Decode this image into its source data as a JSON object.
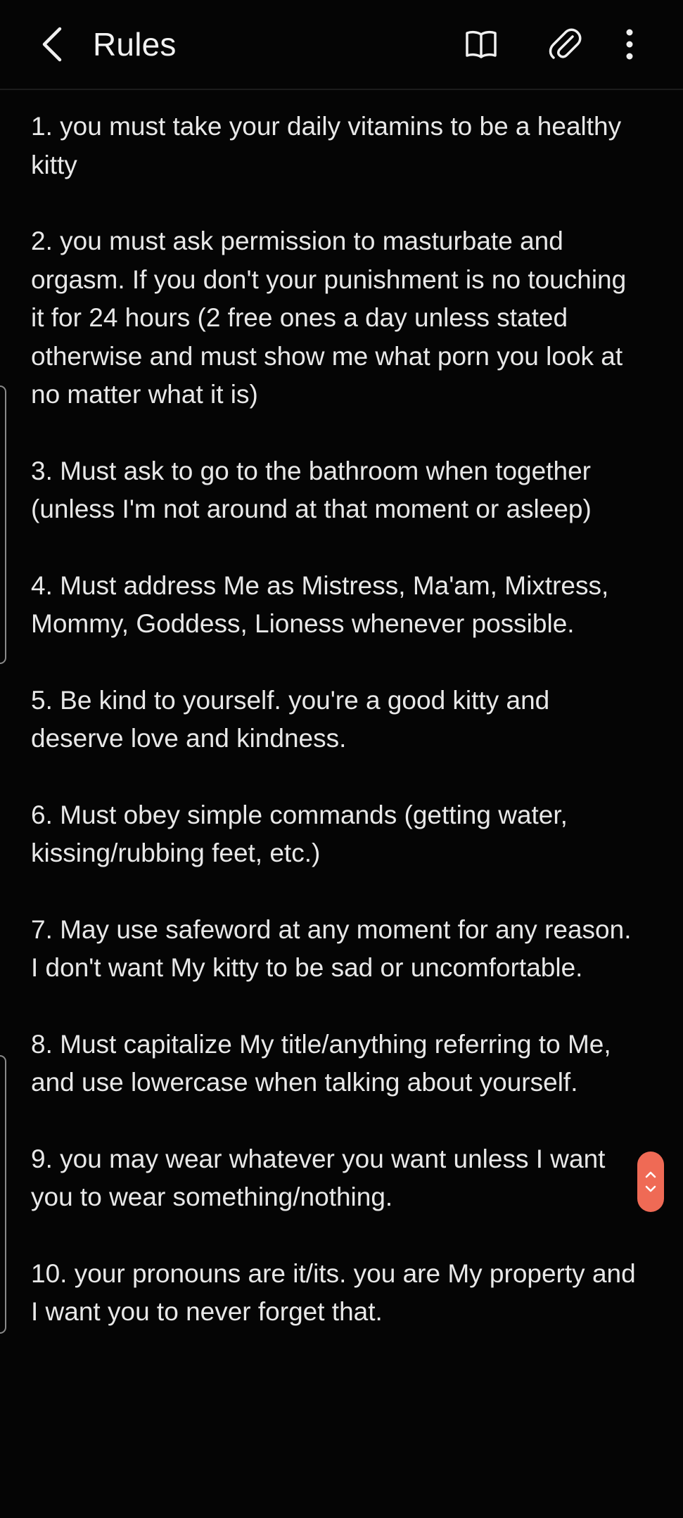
{
  "header": {
    "title": "Rules",
    "back_icon": "chevron-left-icon",
    "reading_icon": "book-icon",
    "attach_icon": "paperclip-icon",
    "more_icon": "more-vertical-icon"
  },
  "rules": [
    "1. you must take your daily vitamins to be a healthy kitty",
    "2. you must ask permission to masturbate and orgasm. If you don't your punishment is no touching it for 24 hours (2 free ones a day unless stated otherwise and must show me what porn you look at no matter what it is)",
    "3. Must ask to go to the bathroom when together (unless I'm not around at that moment or asleep)",
    "4. Must address Me as Mistress, Ma'am, Mixtress, Mommy, Goddess, Lioness whenever possible.",
    "5. Be kind to yourself. you're a good kitty and deserve love and kindness.",
    "6. Must obey simple commands (getting water, kissing/rubbing feet, etc.)",
    "7. May use safeword at any moment for any reason. I don't want My kitty to be sad or uncomfortable.",
    "8. Must capitalize My title/anything referring to Me, and use lowercase when talking about yourself.",
    "9. you may wear whatever you want unless I want you to wear something/nothing.",
    "10. your pronouns are it/its. you are My property and I want you to never forget that."
  ],
  "colors": {
    "background": "#050505",
    "text": "#e8e8e8",
    "scroll_handle": "#ef6a55"
  }
}
